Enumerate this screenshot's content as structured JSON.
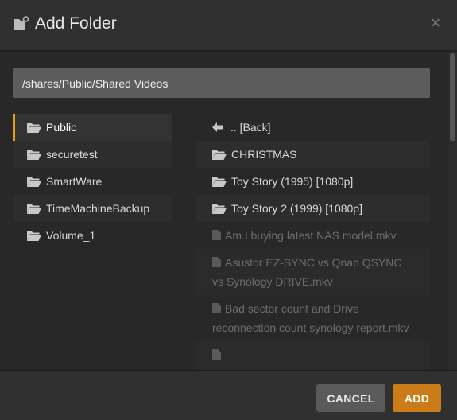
{
  "dialog": {
    "title": "Add Folder",
    "close_symbol": "×",
    "icons": {
      "title": "folder-add-icon",
      "close": "close-icon"
    }
  },
  "path_input": {
    "value": "/shares/Public/Shared Videos"
  },
  "left_folders": [
    {
      "label": "Public",
      "selected": true,
      "icon": "folder-open-icon"
    },
    {
      "label": "securetest",
      "selected": false,
      "icon": "folder-open-icon"
    },
    {
      "label": "SmartWare",
      "selected": false,
      "icon": "folder-open-icon"
    },
    {
      "label": "TimeMachineBackup",
      "selected": false,
      "icon": "folder-open-icon"
    },
    {
      "label": "Volume_1",
      "selected": false,
      "icon": "folder-open-icon"
    }
  ],
  "right_entries": [
    {
      "type": "back",
      "label": ".. [Back]",
      "icon": "arrow-left-icon"
    },
    {
      "type": "folder",
      "label": "CHRISTMAS",
      "icon": "folder-open-icon"
    },
    {
      "type": "folder",
      "label": "Toy Story (1995) [1080p]",
      "icon": "folder-open-icon"
    },
    {
      "type": "folder",
      "label": "Toy Story 2 (1999) [1080p]",
      "icon": "folder-open-icon"
    },
    {
      "type": "file",
      "label": "Am I buying latest NAS model.mkv",
      "icon": "file-icon"
    },
    {
      "type": "file",
      "label": "Asustor EZ-SYNC vs Qnap QSYNC vs Synology DRIVE.mkv",
      "icon": "file-icon"
    },
    {
      "type": "file",
      "label": "Bad sector count and Drive reconnection count synology report.mkv",
      "icon": "file-icon"
    }
  ],
  "footer": {
    "cancel_label": "CANCEL",
    "add_label": "ADD"
  },
  "colors": {
    "accent": "#e5a00d",
    "add_button": "#cc7b19",
    "cancel_button": "#5a5a5a"
  }
}
